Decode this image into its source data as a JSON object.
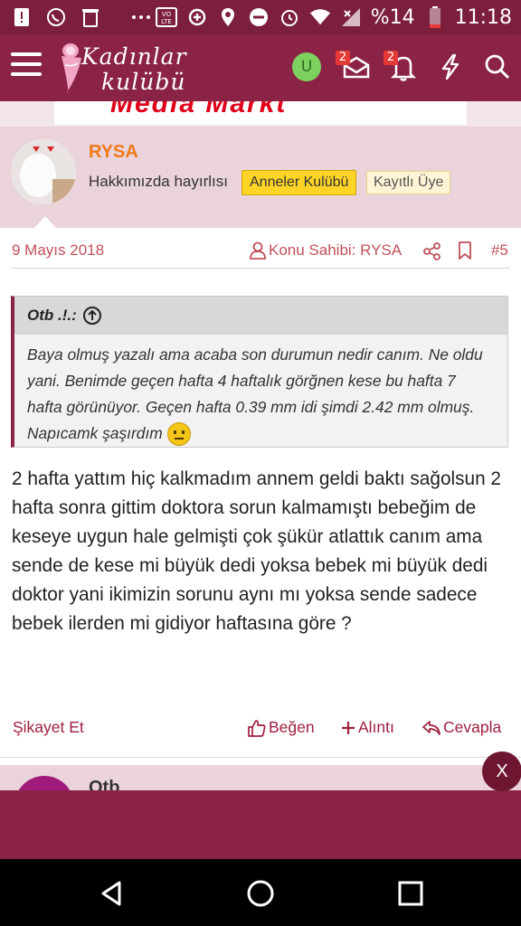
{
  "status_bar": {
    "battery_percent": "%14",
    "time": "11:18",
    "icons": [
      "alert-icon",
      "whatsapp-icon",
      "trash-icon",
      "more-dots-icon",
      "volte-icon",
      "data-saver-icon",
      "location-icon",
      "do-not-disturb-icon",
      "alarm-icon",
      "wifi-icon",
      "signal-icon",
      "battery-icon"
    ]
  },
  "header": {
    "logo_line1": "Kadınlar",
    "logo_line2": "kulübü",
    "user_initial": "U",
    "messages_badge": "2",
    "alerts_badge": "2",
    "icons": [
      "menu-icon",
      "mail-icon",
      "bell-icon",
      "lightning-icon",
      "search-icon"
    ]
  },
  "ad_banner": {
    "text": "Media Markt"
  },
  "post": {
    "username": "RYSA",
    "user_title": "Hakkımızda hayırlısı",
    "tags": [
      "Anneler Kulübü",
      "Kayıtlı Üye"
    ],
    "date": "9 Mayıs 2018",
    "author_label": "Konu Sahibi: RYSA",
    "post_number": "#5",
    "quote": {
      "author": "Otb .!.:",
      "text": "Baya olmuş yazalı ama acaba son durumun nedir canım. Ne oldu yani. Benimde geçen hafta 4 haftalık görğnen kese bu hafta 7 hafta görünüyor. Geçen hafta 0.39 mm idi şimdi 2.42 mm olmuş. Napıcamk şaşırdım"
    },
    "message": "2 hafta yattım hiç kalkmadım annem geldi baktı sağolsun 2 hafta sonra gittim doktora sorun kalmamıştı bebeğim de keseye uygun hale gelmişti çok şükür atlattık canım ama sende de kese mi büyük dedi yoksa bebek mi büyük dedi doktor yani ikimizin sorunu aynı mı yoksa sende sadece bebek ilerden mi gidiyor haftasına göre ?",
    "actions": {
      "report": "Şikayet Et",
      "like": "Beğen",
      "quote": "Alıntı",
      "reply": "Cevapla"
    }
  },
  "next_post": {
    "username": "Otb"
  },
  "close_button": "X",
  "colors": {
    "brand": "#8a2346",
    "accent_orange": "#f07a1a",
    "link": "#a0203f",
    "tag_yellow": "#ffd426"
  }
}
